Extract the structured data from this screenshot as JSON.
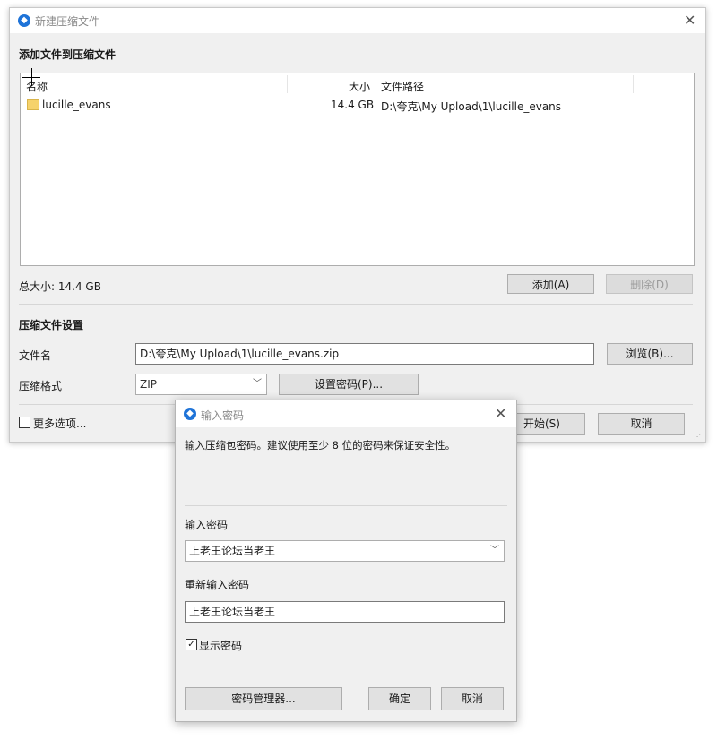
{
  "main_window": {
    "title": "新建压缩文件",
    "files_section_title": "添加文件到压缩文件",
    "columns": {
      "name": "名称",
      "size": "大小",
      "path": "文件路径"
    },
    "files": [
      {
        "name": "lucille_evans",
        "size": "14.4 GB",
        "path": "D:\\夸克\\My Upload\\1\\lucille_evans"
      }
    ],
    "total_size": "总大小: 14.4 GB",
    "add_button": "添加(A)",
    "delete_button": "删除(D)",
    "settings_title": "压缩文件设置",
    "filename_label": "文件名",
    "filename_value": "D:\\夸克\\My Upload\\1\\lucille_evans.zip",
    "browse_button": "浏览(B)...",
    "format_label": "压缩格式",
    "format_value": "ZIP",
    "set_password_button": "设置密码(P)...",
    "more_options_label": "更多选项...",
    "start_button": "开始(S)",
    "cancel_button": "取消"
  },
  "password_dialog": {
    "title": "输入密码",
    "description": "输入压缩包密码。建议使用至少 8 位的密码来保证安全性。",
    "password_label": "输入密码",
    "password_value": "上老王论坛当老王",
    "reenter_label": "重新输入密码",
    "reenter_value": "上老王论坛当老王",
    "show_password_label": "显示密码",
    "show_password_checked": true,
    "manager_button": "密码管理器...",
    "ok_button": "确定",
    "cancel_button": "取消"
  },
  "icons": {
    "app": "app-logo-icon",
    "close": "close-icon",
    "folder": "folder-icon",
    "chevron": "chevron-down-icon",
    "checkmark": "checkmark-icon"
  }
}
